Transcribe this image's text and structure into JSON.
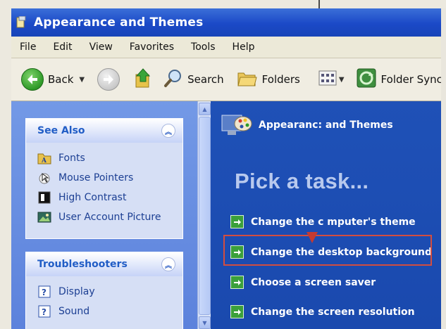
{
  "window": {
    "title": "Appearance and Themes"
  },
  "menu": [
    "File",
    "Edit",
    "View",
    "Favorites",
    "Tools",
    "Help"
  ],
  "toolbar": {
    "back_label": "Back",
    "search_label": "Search",
    "folders_label": "Folders",
    "sync_label": "Folder Sync"
  },
  "sidebar": {
    "see_also": {
      "title": "See Also",
      "items": [
        {
          "label": "Fonts",
          "icon": "fonts-folder-icon"
        },
        {
          "label": "Mouse Pointers",
          "icon": "mouse-pointer-icon"
        },
        {
          "label": "High Contrast",
          "icon": "high-contrast-icon"
        },
        {
          "label": "User Account Picture",
          "icon": "user-picture-icon"
        }
      ]
    },
    "troubleshooters": {
      "title": "Troubleshooters",
      "items": [
        {
          "label": "Display",
          "icon": "help-icon"
        },
        {
          "label": "Sound",
          "icon": "help-icon"
        }
      ]
    }
  },
  "content": {
    "heading": "Appearanc: and Themes",
    "pick_title": "Pick a task...",
    "tasks": [
      "Change the c mputer's theme",
      "Change the desktop background",
      "Choose a screen saver",
      "Change the screen resolution"
    ]
  },
  "colors": {
    "title_blue": "#1b49c7",
    "sidebar_blue": "#6a8fe2",
    "content_blue": "#1f51b7",
    "highlight_red": "#d34d3f",
    "task_green": "#3ba03b"
  }
}
